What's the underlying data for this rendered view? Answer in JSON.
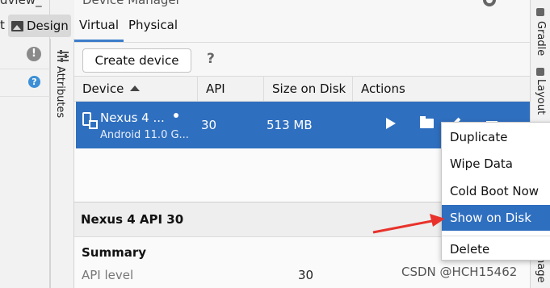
{
  "left_panel": {
    "title_fragment": "dview_",
    "t_fragment": "t",
    "design_label": "Design",
    "warn_glyph": "!",
    "help_glyph": "?"
  },
  "attributes_strip": {
    "label": "Attributes"
  },
  "device_manager": {
    "title": "Device Manager",
    "tabs": [
      {
        "label": "Virtual"
      },
      {
        "label": "Physical"
      }
    ],
    "toolbar": {
      "create_label": "Create device",
      "help_glyph": "?"
    },
    "columns": [
      {
        "label": "Device"
      },
      {
        "label": "API"
      },
      {
        "label": "Size on Disk"
      },
      {
        "label": "Actions"
      }
    ],
    "device": {
      "name": "Nexus 4 ...",
      "subtitle": "Android 11.0 G...",
      "api": "30",
      "size": "513 MB"
    },
    "details": {
      "title": "Nexus 4 API 30",
      "summary_label": "Summary",
      "api_key": "API level",
      "api_value": "30"
    }
  },
  "right_strip": {
    "labels": [
      "Gradle",
      "Layout",
      "nage"
    ]
  },
  "context_menu": {
    "items": [
      {
        "label": "Duplicate"
      },
      {
        "label": "Wipe Data"
      },
      {
        "label": "Cold Boot Now"
      },
      {
        "label": "Show on Disk"
      },
      {
        "label": "Delete"
      }
    ],
    "highlighted_index": 3
  },
  "watermark": "CSDN @HCH15462",
  "colors": {
    "selection": "#2f6fbf",
    "annotation_arrow": "#e8322b"
  }
}
